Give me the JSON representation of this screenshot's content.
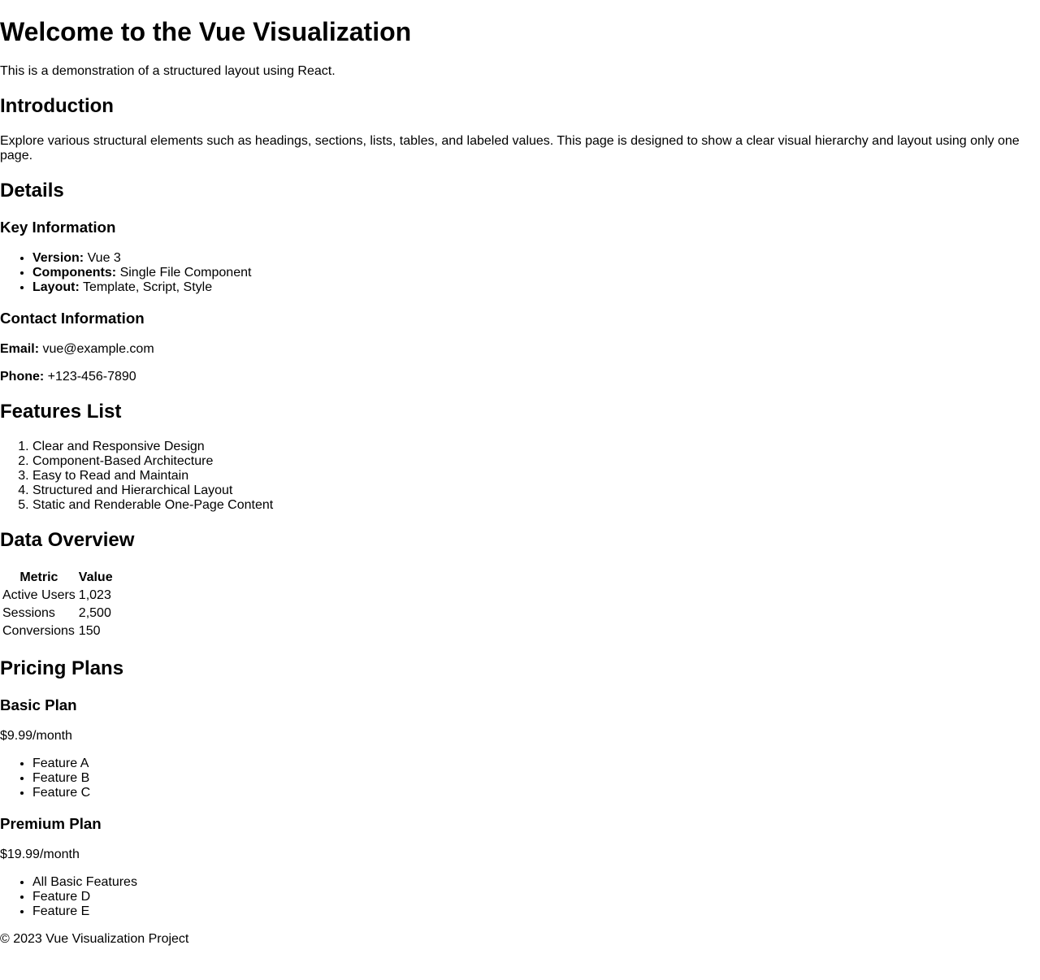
{
  "header": {
    "title": "Welcome to the Vue Visualization",
    "subtitle": "This is a demonstration of a structured layout using React."
  },
  "introduction": {
    "heading": "Introduction",
    "text": "Explore various structural elements such as headings, sections, lists, tables, and labeled values. This page is designed to show a clear visual hierarchy and layout using only one page."
  },
  "details": {
    "heading": "Details",
    "key_info": {
      "heading": "Key Information",
      "items": [
        {
          "label": "Version:",
          "value": "Vue 3"
        },
        {
          "label": "Components:",
          "value": "Single File Component"
        },
        {
          "label": "Layout:",
          "value": "Template, Script, Style"
        }
      ]
    },
    "contact": {
      "heading": "Contact Information",
      "email_label": "Email:",
      "email_value": "vue@example.com",
      "phone_label": "Phone:",
      "phone_value": "+123-456-7890"
    }
  },
  "features": {
    "heading": "Features List",
    "items": [
      "Clear and Responsive Design",
      "Component-Based Architecture",
      "Easy to Read and Maintain",
      "Structured and Hierarchical Layout",
      "Static and Renderable One-Page Content"
    ]
  },
  "data_overview": {
    "heading": "Data Overview",
    "columns": [
      "Metric",
      "Value"
    ],
    "rows": [
      [
        "Active Users",
        "1,023"
      ],
      [
        "Sessions",
        "2,500"
      ],
      [
        "Conversions",
        "150"
      ]
    ]
  },
  "pricing": {
    "heading": "Pricing Plans",
    "plans": [
      {
        "name": "Basic Plan",
        "price": "$9.99/month",
        "features": [
          "Feature A",
          "Feature B",
          "Feature C"
        ]
      },
      {
        "name": "Premium Plan",
        "price": "$19.99/month",
        "features": [
          "All Basic Features",
          "Feature D",
          "Feature E"
        ]
      }
    ]
  },
  "footer": {
    "text": "© 2023 Vue Visualization Project"
  }
}
